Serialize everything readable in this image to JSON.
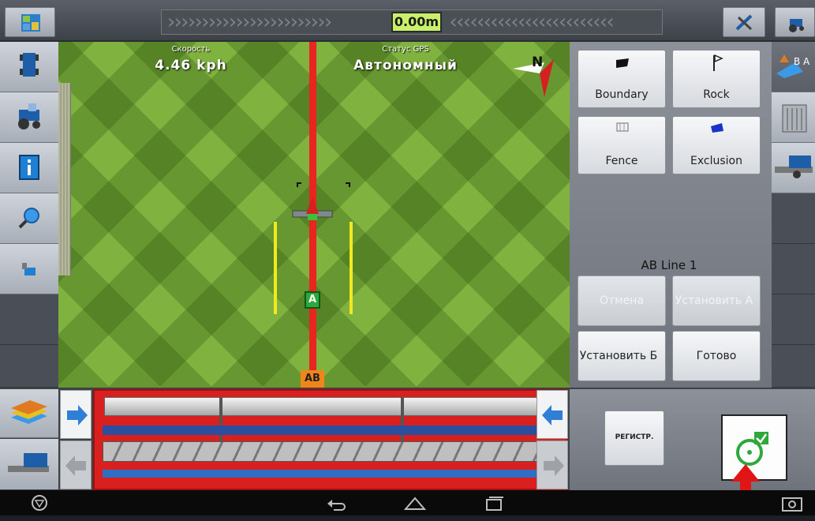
{
  "top_bar": {
    "offset_value": "0.00m",
    "chevrons_left": "››››››››››››››››››››››››",
    "chevrons_right": "‹‹‹‹‹‹‹‹‹‹‹‹‹‹‹‹‹‹‹‹‹‹‹‹"
  },
  "map": {
    "speed_label": "Скорость",
    "speed_value": "4.46 kph",
    "gps_label": "Статус GPS",
    "gps_value": "Автономный",
    "compass_label": "N",
    "marker_a": "A",
    "marker_ab": "AB"
  },
  "right_panel": {
    "boundary_label": "Boundary",
    "rock_label": "Rock",
    "fence_label": "Fence",
    "exclusion_label": "Exclusion",
    "ab_line_title": "AB Line 1",
    "cancel_label": "Отмена",
    "set_a_label": "Установить А",
    "set_b_label": "Установить Б",
    "done_label": "Готово"
  },
  "right_toolbar": {
    "ab_tab_label": "B A"
  },
  "bottom": {
    "register_label": "РЕГИСТР."
  },
  "colors": {
    "guidance_line": "#e8261f",
    "swath_edge": "#f2ea1c",
    "offset_display": "#c8f06a",
    "arrow_active": "#2f7fd6",
    "highlight_arrow": "#e01616"
  }
}
